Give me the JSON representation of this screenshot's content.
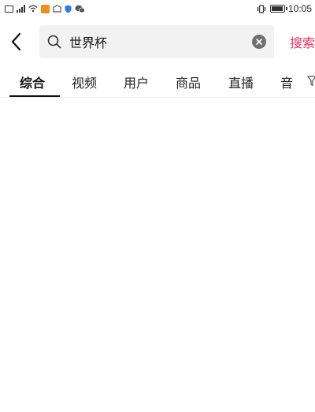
{
  "status_bar": {
    "time": "10:05",
    "icons": [
      "sim-icon",
      "signal-icon",
      "wifi-icon",
      "app-notification-icon",
      "app-notification-icon",
      "shield-icon",
      "wechat-icon",
      "vibrate-icon",
      "battery-icon"
    ],
    "battery_level": 0.8,
    "colors": {
      "app1": "#e89020",
      "app2": "#f08a1e",
      "shield": "#2f7de1"
    }
  },
  "search": {
    "query": "世界杯",
    "submit_label": "搜索",
    "accent_color": "#e8325f"
  },
  "tabs": [
    {
      "label": "综合",
      "active": true
    },
    {
      "label": "视频",
      "active": false
    },
    {
      "label": "用户",
      "active": false
    },
    {
      "label": "商品",
      "active": false
    },
    {
      "label": "直播",
      "active": false
    },
    {
      "label": "音",
      "active": false
    }
  ],
  "icons": {
    "back": "chevron-left-icon",
    "search": "search-icon",
    "clear": "close-icon",
    "filter": "filter-icon"
  }
}
